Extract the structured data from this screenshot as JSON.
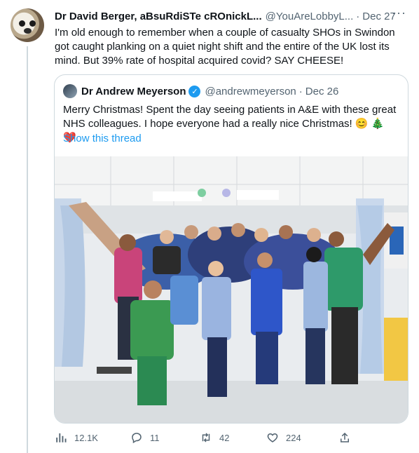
{
  "tweet": {
    "author_name": "Dr David Berger, aBsuRdiSTe cROnickL...",
    "handle": "@YouAreLobbyL...",
    "separator": "·",
    "date": "Dec 27",
    "more": "···",
    "text": "I'm old enough to remember when a couple of casualty SHOs in Swindon got caught planking on a quiet night shift and the entire of the UK lost its mind. But 39% rate of hospital acquired covid? SAY CHEESE!"
  },
  "quote": {
    "author_name": "Dr Andrew Meyerson",
    "verified_mark": "✓",
    "handle": "@andrewmeyerson",
    "separator": "·",
    "date": "Dec 26",
    "text": "Merry Christmas! Spent the day seeing patients in A&E with these great NHS colleagues. I hope everyone had a really nice Christmas!",
    "emoji_1": "😊",
    "emoji_2": "🎄",
    "emoji_3": "❤️",
    "thread_link": "Show this thread"
  },
  "actions": {
    "views": "12.1K",
    "replies": "11",
    "retweets": "42",
    "likes": "224"
  },
  "colors": {
    "accent": "#1d9bf0",
    "secondary_text": "#536471",
    "border": "#cfd9de"
  }
}
